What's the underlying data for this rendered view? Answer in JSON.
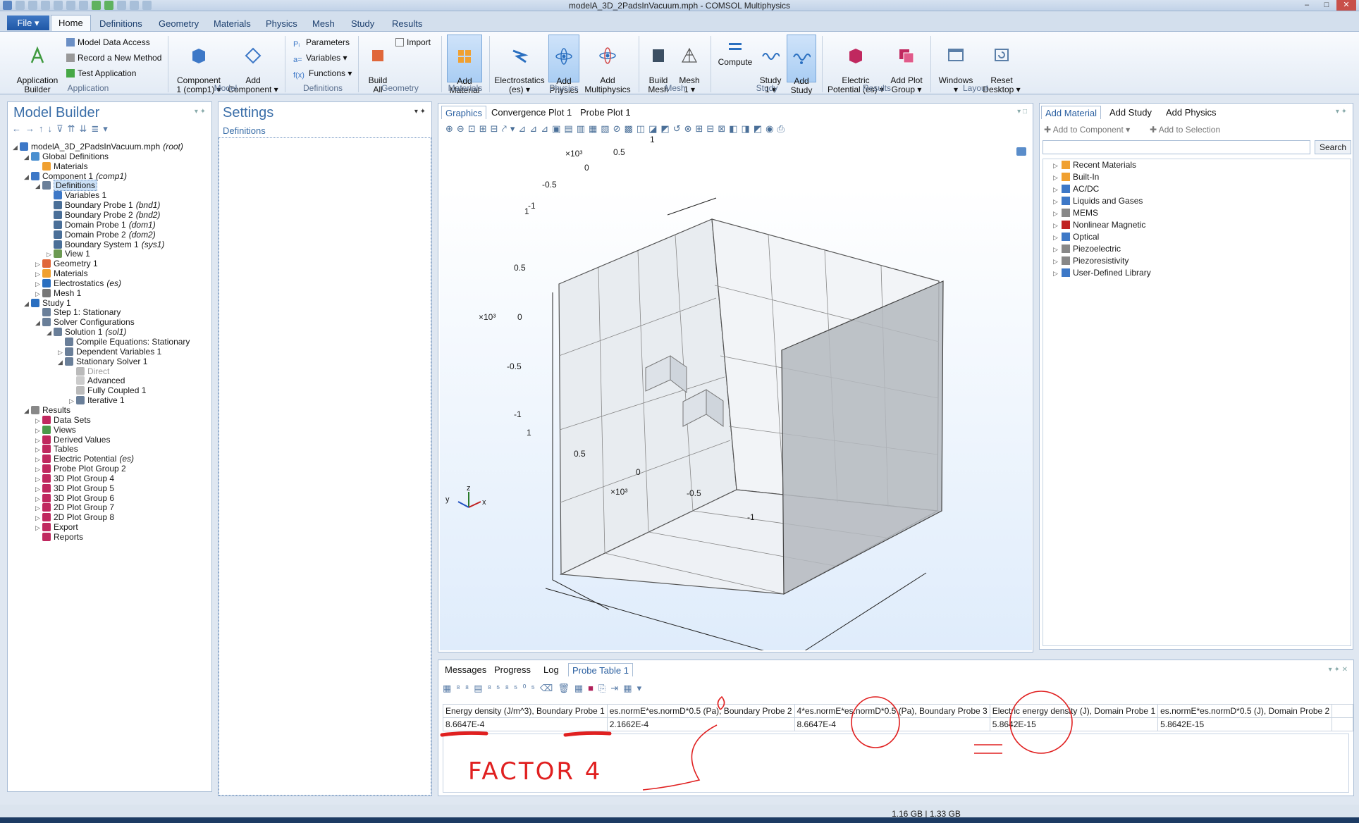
{
  "window": {
    "title": "modelA_3D_2PadsInVacuum.mph - COMSOL Multiphysics",
    "minimize": "–",
    "maximize": "□",
    "close": "✕"
  },
  "ribbon": {
    "file_label": "File ▾",
    "tabs": [
      "Home",
      "Definitions",
      "Geometry",
      "Materials",
      "Physics",
      "Mesh",
      "Study",
      "Results"
    ],
    "application": {
      "builder": "Application\nBuilder",
      "model_data_access": "Model Data Access",
      "record_method": "Record a New Method",
      "test_application": "Test Application",
      "group": "Application"
    },
    "model": {
      "component": "Component\n1 (comp1) ▾",
      "add_component": "Add\nComponent ▾",
      "group": "Model"
    },
    "definitions": {
      "parameters": "Parameters",
      "variables": "Variables ▾",
      "functions": "Functions ▾",
      "group": "Definitions"
    },
    "geometry": {
      "build_all": "Build\nAll",
      "import": "Import",
      "group": "Geometry"
    },
    "materials": {
      "add_material": "Add\nMaterial",
      "group": "Materials"
    },
    "physics": {
      "electrostatics": "Electrostatics\n(es) ▾",
      "add_physics": "Add\nPhysics",
      "add_multiphysics": "Add\nMultiphysics",
      "group": "Physics"
    },
    "mesh": {
      "build_mesh": "Build\nMesh",
      "mesh1": "Mesh\n1 ▾",
      "group": "Mesh"
    },
    "study": {
      "compute": "Compute",
      "study1": "Study\n1 ▾",
      "add_study": "Add\nStudy",
      "group": "Study"
    },
    "results": {
      "electric_potential": "Electric\nPotential (es) ▾",
      "add_plot_group": "Add Plot\nGroup ▾",
      "group": "Results"
    },
    "layout": {
      "windows": "Windows\n▾",
      "reset_desktop": "Reset\nDesktop ▾",
      "group": "Layout"
    }
  },
  "model_builder": {
    "title": "Model Builder",
    "tree": [
      {
        "label": "modelA_3D_2PadsInVacuum.mph",
        "tag": "(root)",
        "level": 0,
        "icon": "model-icon",
        "twisty": "◢"
      },
      {
        "label": "Global Definitions",
        "tag": "",
        "level": 1,
        "icon": "globe-icon",
        "twisty": "◢"
      },
      {
        "label": "Materials",
        "tag": "",
        "level": 2,
        "icon": "materials-icon",
        "twisty": ""
      },
      {
        "label": "Component 1",
        "tag": "(comp1)",
        "level": 1,
        "icon": "component-icon",
        "twisty": "◢"
      },
      {
        "label": "Definitions",
        "tag": "",
        "level": 2,
        "icon": "definitions-icon",
        "twisty": "◢",
        "selected": true
      },
      {
        "label": "Variables 1",
        "tag": "",
        "level": 3,
        "icon": "variables-icon",
        "twisty": ""
      },
      {
        "label": "Boundary Probe 1",
        "tag": "(bnd1)",
        "level": 3,
        "icon": "probe-icon",
        "twisty": ""
      },
      {
        "label": "Boundary Probe 2",
        "tag": "(bnd2)",
        "level": 3,
        "icon": "probe-icon",
        "twisty": ""
      },
      {
        "label": "Domain Probe 1",
        "tag": "(dom1)",
        "level": 3,
        "icon": "probe-icon",
        "twisty": ""
      },
      {
        "label": "Domain Probe 2",
        "tag": "(dom2)",
        "level": 3,
        "icon": "probe-icon",
        "twisty": ""
      },
      {
        "label": "Boundary System 1",
        "tag": "(sys1)",
        "level": 3,
        "icon": "coordinate-system-icon",
        "twisty": ""
      },
      {
        "label": "View 1",
        "tag": "",
        "level": 3,
        "icon": "view-icon",
        "twisty": "▷"
      },
      {
        "label": "Geometry 1",
        "tag": "",
        "level": 2,
        "icon": "geometry-icon",
        "twisty": "▷"
      },
      {
        "label": "Materials",
        "tag": "",
        "level": 2,
        "icon": "materials-icon",
        "twisty": "▷"
      },
      {
        "label": "Electrostatics",
        "tag": "(es)",
        "level": 2,
        "icon": "electrostatics-icon",
        "twisty": "▷"
      },
      {
        "label": "Mesh 1",
        "tag": "",
        "level": 2,
        "icon": "mesh-icon",
        "twisty": "▷"
      },
      {
        "label": "Study 1",
        "tag": "",
        "level": 1,
        "icon": "study-icon",
        "twisty": "◢"
      },
      {
        "label": "Step 1: Stationary",
        "tag": "",
        "level": 2,
        "icon": "step-icon",
        "twisty": ""
      },
      {
        "label": "Solver Configurations",
        "tag": "",
        "level": 2,
        "icon": "solver-config-icon",
        "twisty": "◢"
      },
      {
        "label": "Solution 1",
        "tag": "(sol1)",
        "level": 3,
        "icon": "solution-icon",
        "twisty": "◢"
      },
      {
        "label": "Compile Equations: Stationary",
        "tag": "",
        "level": 4,
        "icon": "compile-icon",
        "twisty": ""
      },
      {
        "label": "Dependent Variables 1",
        "tag": "",
        "level": 4,
        "icon": "dependent-variables-icon",
        "twisty": "▷"
      },
      {
        "label": "Stationary Solver 1",
        "tag": "",
        "level": 4,
        "icon": "stationary-solver-icon",
        "twisty": "◢"
      },
      {
        "label": "Direct",
        "tag": "",
        "level": 5,
        "icon": "direct-icon",
        "twisty": "",
        "disabled": true
      },
      {
        "label": "Advanced",
        "tag": "",
        "level": 5,
        "icon": "advanced-icon",
        "twisty": ""
      },
      {
        "label": "Fully Coupled 1",
        "tag": "",
        "level": 5,
        "icon": "fully-coupled-icon",
        "twisty": ""
      },
      {
        "label": "Iterative 1",
        "tag": "",
        "level": 5,
        "icon": "iterative-icon",
        "twisty": "▷"
      },
      {
        "label": "Results",
        "tag": "",
        "level": 1,
        "icon": "results-icon",
        "twisty": "◢"
      },
      {
        "label": "Data Sets",
        "tag": "",
        "level": 2,
        "icon": "datasets-icon",
        "twisty": "▷"
      },
      {
        "label": "Views",
        "tag": "",
        "level": 2,
        "icon": "views-icon",
        "twisty": "▷"
      },
      {
        "label": "Derived Values",
        "tag": "",
        "level": 2,
        "icon": "derived-values-icon",
        "twisty": "▷"
      },
      {
        "label": "Tables",
        "tag": "",
        "level": 2,
        "icon": "tables-icon",
        "twisty": "▷"
      },
      {
        "label": "Electric Potential",
        "tag": "(es)",
        "level": 2,
        "icon": "plot-group-icon",
        "twisty": "▷"
      },
      {
        "label": "Probe Plot Group 2",
        "tag": "",
        "level": 2,
        "icon": "probe-plot-icon",
        "twisty": "▷"
      },
      {
        "label": "3D Plot Group 4",
        "tag": "",
        "level": 2,
        "icon": "plot-group-icon",
        "twisty": "▷"
      },
      {
        "label": "3D Plot Group 5",
        "tag": "",
        "level": 2,
        "icon": "plot-group-icon",
        "twisty": "▷"
      },
      {
        "label": "3D Plot Group 6",
        "tag": "",
        "level": 2,
        "icon": "plot-group-icon",
        "twisty": "▷"
      },
      {
        "label": "2D Plot Group 7",
        "tag": "",
        "level": 2,
        "icon": "plot-group-icon",
        "twisty": "▷"
      },
      {
        "label": "2D Plot Group 8",
        "tag": "",
        "level": 2,
        "icon": "plot-group-icon",
        "twisty": "▷"
      },
      {
        "label": "Export",
        "tag": "",
        "level": 2,
        "icon": "export-icon",
        "twisty": "▷"
      },
      {
        "label": "Reports",
        "tag": "",
        "level": 2,
        "icon": "reports-icon",
        "twisty": ""
      }
    ]
  },
  "settings": {
    "title": "Settings",
    "subtitle": "Definitions"
  },
  "graphics": {
    "tabs": [
      "Graphics",
      "Convergence Plot 1",
      "Probe Plot 1"
    ],
    "axis_ticks": {
      "top": [
        "1",
        "0.5",
        "0",
        "-0.5",
        "-1"
      ],
      "vertical": [
        "1",
        "0.5",
        "0",
        "-0.5",
        "-1"
      ],
      "bottom": [
        "1",
        "0.5",
        "0",
        "-0.5",
        "-1"
      ],
      "scale": "×10³"
    },
    "triad": {
      "x": "x",
      "y": "y",
      "z": "z"
    }
  },
  "add_material": {
    "tabs": [
      "Add Material",
      "Add Study",
      "Add Physics"
    ],
    "add_to_component": "Add to Component ▾",
    "add_to_selection": "Add to Selection",
    "search_value": "",
    "search_button": "Search",
    "libraries": [
      {
        "label": "Recent Materials",
        "icon": "recent-materials-icon"
      },
      {
        "label": "Built-In",
        "icon": "built-in-icon"
      },
      {
        "label": "AC/DC",
        "icon": "acdc-icon"
      },
      {
        "label": "Liquids and Gases",
        "icon": "liquids-gases-icon"
      },
      {
        "label": "MEMS",
        "icon": "mems-icon"
      },
      {
        "label": "Nonlinear Magnetic",
        "icon": "magnet-icon"
      },
      {
        "label": "Optical",
        "icon": "optical-icon"
      },
      {
        "label": "Piezoelectric",
        "icon": "piezoelectric-icon"
      },
      {
        "label": "Piezoresistivity",
        "icon": "piezoresistivity-icon"
      },
      {
        "label": "User-Defined Library",
        "icon": "user-library-icon"
      }
    ]
  },
  "bottom": {
    "tabs": [
      "Messages",
      "Progress",
      "Log",
      "Probe Table 1"
    ],
    "table": {
      "headers": [
        "Energy density (J/m^3), Boundary Probe 1",
        "es.normE*es.normD*0.5 (Pa), Boundary Probe 2",
        "4*es.normE*es.normD*0.5 (Pa), Boundary Probe 3",
        "Electric energy density (J), Domain Probe 1",
        "es.normE*es.normD*0.5 (J), Domain Probe 2"
      ],
      "values": [
        "8.6647E-4",
        "2.1662E-4",
        "8.6647E-4",
        "5.8642E-15",
        "5.8642E-15"
      ]
    },
    "annotation": "FACTOR 4",
    "equals": "="
  },
  "status": {
    "memory": "1.16 GB | 1.33 GB"
  },
  "colors": {
    "accent": "#2a5fa0",
    "annotation_red": "#e02020",
    "ribbon_highlight": "#a9cdf3"
  }
}
